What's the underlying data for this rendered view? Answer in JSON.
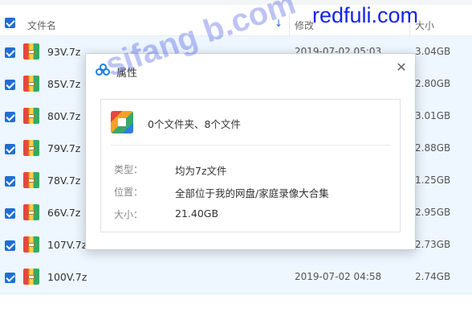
{
  "watermark": {
    "site": "redfuli.com",
    "diagonal": "sifang   b.com"
  },
  "columns": {
    "name": "文件名",
    "sort_icon": "↓",
    "modified": "修改",
    "size": "大小"
  },
  "files": [
    {
      "name": "93V.7z",
      "date": "2019-07-02 05:03",
      "size": "3.04GB"
    },
    {
      "name": "85V.7z",
      "date": "",
      "size": "2.80GB"
    },
    {
      "name": "80V.7z",
      "date": "",
      "size": "3.01GB"
    },
    {
      "name": "79V.7z",
      "date": "",
      "size": "2.88GB"
    },
    {
      "name": "78V.7z",
      "date": "",
      "size": "1.25GB"
    },
    {
      "name": "66V.7z",
      "date": "",
      "size": "2.95GB"
    },
    {
      "name": "107V.7z",
      "date": "",
      "size": "2.73GB"
    },
    {
      "name": "100V.7z",
      "date": "2019-07-02 04:58",
      "size": "2.74GB"
    }
  ],
  "dialog": {
    "title": "属性",
    "close": "✕",
    "summary": "0个文件夹、8个文件",
    "type_label": "类型：",
    "type_value": "均为7z文件",
    "location_label": "位置：",
    "location_value": "全部位于我的网盘/家庭录像大合集",
    "size_label": "大小：",
    "size_value": "21.40GB"
  },
  "colors": {
    "accent": "#1d6fd6",
    "row_bg": "#eef6ff",
    "watermark": "#1424e8"
  },
  "icons": {
    "archive": "7z-archive-icon",
    "properties": "properties-icon"
  }
}
